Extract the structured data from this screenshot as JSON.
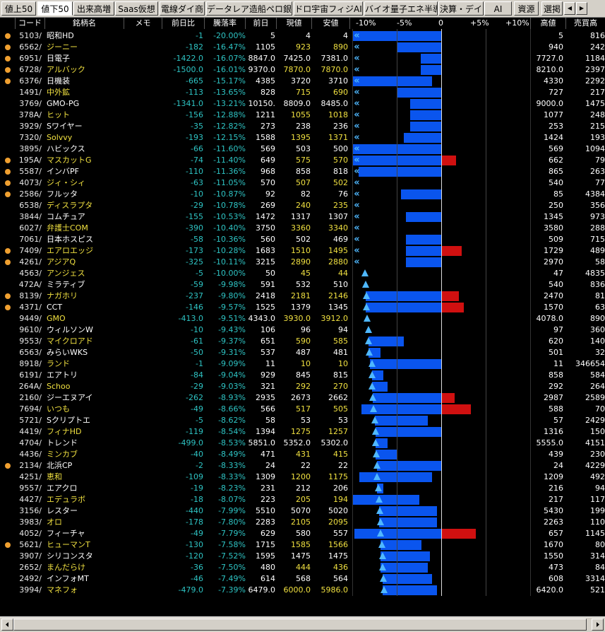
{
  "tabs": [
    {
      "label": "値上50",
      "active": false
    },
    {
      "label": "値下50",
      "active": true
    },
    {
      "label": "出来高増",
      "active": false
    },
    {
      "label": "Saas仮想",
      "active": false
    },
    {
      "label": "電線ダイ商",
      "active": false
    },
    {
      "label": "データレア造船ペロ銀行",
      "active": false
    },
    {
      "label": "ドロ宇宙フィジAI",
      "active": false
    },
    {
      "label": "バイオ量子エネ半導",
      "active": false
    },
    {
      "label": "決算・デイ",
      "active": false
    },
    {
      "label": "AI",
      "active": false
    },
    {
      "label": "資源",
      "active": false
    },
    {
      "label": "選掲",
      "active": false
    }
  ],
  "columns": {
    "code": "コード",
    "name": "銘柄名",
    "memo": "メモ",
    "chg": "前日比",
    "rate": "騰落率",
    "prev": "前日",
    "cur": "現値",
    "low": "安値",
    "hi": "高値",
    "vol": "売買高",
    "scale": [
      "-10%",
      "-5%",
      "0",
      "+5%",
      "+10%"
    ]
  },
  "colors": {
    "name_yellow": "#f0e040",
    "name_white": "#ffffff",
    "down": "#2ec4c4",
    "bar": "#0a55ee",
    "bar_red": "#d01010",
    "marker": "#4fb8ff",
    "dot": "#f0a030"
  },
  "rows": [
    {
      "code": "5103/",
      "name": "昭和HD",
      "nc": "w",
      "dot": true,
      "chg": "-1",
      "rate": "-20.00%",
      "prev": "5",
      "cur": "4",
      "low": "4",
      "hi": "5",
      "vol": "816",
      "bl": -1.0,
      "br": 0.0,
      "mk": "arrow",
      "mp": -0.95,
      "rc": 0,
      "rr": 0
    },
    {
      "code": "6562/",
      "name": "ジーニー",
      "nc": "y",
      "dot": true,
      "chg": "-182",
      "rate": "-16.47%",
      "prev": "1105",
      "cur": "923",
      "low": "890",
      "hi": "940",
      "vol": "242",
      "bl": -0.5,
      "br": 0.0,
      "mk": "arrow",
      "mp": -0.95,
      "rc": 0,
      "rr": 0
    },
    {
      "code": "6951/",
      "name": "日電子",
      "nc": "w",
      "dot": true,
      "chg": "-1422.0",
      "rate": "-16.07%",
      "prev": "8847.0",
      "cur": "7425.0",
      "low": "7381.0",
      "hi": "7727.0",
      "vol": "1184",
      "bl": -0.23,
      "br": 0.0,
      "mk": "arrow",
      "mp": -0.95,
      "rc": 0,
      "rr": 0
    },
    {
      "code": "6728/",
      "name": "アルバック",
      "nc": "y",
      "dot": true,
      "chg": "-1500.0",
      "rate": "-16.01%",
      "prev": "9370.0",
      "cur": "7870.0",
      "low": "7870.0",
      "hi": "8210.0",
      "vol": "2397",
      "bl": -0.23,
      "br": 0.0,
      "mk": "arrow",
      "mp": -0.95,
      "rc": 0,
      "rr": 0
    },
    {
      "code": "6376/",
      "name": "日機装",
      "nc": "w",
      "dot": true,
      "chg": "-665",
      "rate": "-15.17%",
      "prev": "4385",
      "cur": "3720",
      "low": "3710",
      "hi": "4330",
      "vol": "2292",
      "bl": -1.0,
      "br": -0.1,
      "mk": "arrow",
      "mp": -0.95,
      "rc": 0,
      "rr": 0
    },
    {
      "code": "1491/",
      "name": "中外鉱",
      "nc": "y",
      "dot": false,
      "chg": "-113",
      "rate": "-13.65%",
      "prev": "828",
      "cur": "715",
      "low": "690",
      "hi": "727",
      "vol": "217",
      "bl": -0.5,
      "br": 0.0,
      "mk": "arrow",
      "mp": -0.95,
      "rc": 0,
      "rr": 0
    },
    {
      "code": "3769/",
      "name": "GMO-PG",
      "nc": "w",
      "dot": false,
      "chg": "-1341.0",
      "rate": "-13.21%",
      "prev": "10150.",
      "cur": "8809.0",
      "low": "8485.0",
      "hi": "9000.0",
      "vol": "1475",
      "bl": -0.35,
      "br": 0.0,
      "mk": "arrow",
      "mp": -0.95,
      "rc": 0,
      "rr": 0
    },
    {
      "code": "378A/",
      "name": "ヒット",
      "nc": "y",
      "dot": false,
      "chg": "-156",
      "rate": "-12.88%",
      "prev": "1211",
      "cur": "1055",
      "low": "1018",
      "hi": "1077",
      "vol": "248",
      "bl": -0.35,
      "br": 0.0,
      "mk": "arrow",
      "mp": -0.95,
      "rc": 0,
      "rr": 0
    },
    {
      "code": "3929/",
      "name": "Sワイヤー",
      "nc": "w",
      "dot": false,
      "chg": "-35",
      "rate": "-12.82%",
      "prev": "273",
      "cur": "238",
      "low": "236",
      "hi": "253",
      "vol": "215",
      "bl": -0.35,
      "br": 0.0,
      "mk": "arrow",
      "mp": -0.95,
      "rc": 0,
      "rr": 0
    },
    {
      "code": "7320/",
      "name": "Solvvy",
      "nc": "y",
      "dot": false,
      "chg": "-193",
      "rate": "-12.15%",
      "prev": "1588",
      "cur": "1395",
      "low": "1371",
      "hi": "1424",
      "vol": "193",
      "bl": -0.42,
      "br": 0.0,
      "mk": "arrow",
      "mp": -0.95,
      "rc": 0,
      "rr": 0
    },
    {
      "code": "3895/",
      "name": "ハビックス",
      "nc": "w",
      "dot": false,
      "chg": "-66",
      "rate": "-11.60%",
      "prev": "569",
      "cur": "503",
      "low": "500",
      "hi": "569",
      "vol": "1094",
      "bl": -1.0,
      "br": 0.0,
      "mk": "arrow",
      "mp": -0.95,
      "rc": 0,
      "rr": 0
    },
    {
      "code": "195A/",
      "name": "マスカットG",
      "nc": "y",
      "dot": true,
      "chg": "-74",
      "rate": "-11.40%",
      "prev": "649",
      "cur": "575",
      "low": "570",
      "hi": "662",
      "vol": "79",
      "bl": -1.0,
      "br": 0.0,
      "mk": "arrow",
      "mp": -0.95,
      "rc": 0.0,
      "rr": 0.17
    },
    {
      "code": "5587/",
      "name": "インバPF",
      "nc": "w",
      "dot": true,
      "chg": "-110",
      "rate": "-11.36%",
      "prev": "968",
      "cur": "858",
      "low": "818",
      "hi": "865",
      "vol": "263",
      "bl": -0.93,
      "br": 0.0,
      "mk": "arrow",
      "mp": -0.95,
      "rc": 0,
      "rr": 0
    },
    {
      "code": "4073/",
      "name": "ジィ・シィ",
      "nc": "y",
      "dot": true,
      "chg": "-63",
      "rate": "-11.05%",
      "prev": "570",
      "cur": "507",
      "low": "502",
      "hi": "540",
      "vol": "77",
      "bl": -0.45,
      "br": -0.45,
      "mk": "arrow",
      "mp": -0.95,
      "rc": 0,
      "rr": 0
    },
    {
      "code": "2586/",
      "name": "フルッタ",
      "nc": "w",
      "dot": true,
      "chg": "-10",
      "rate": "-10.87%",
      "prev": "92",
      "cur": "82",
      "low": "76",
      "hi": "85",
      "vol": "4384",
      "bl": -0.45,
      "br": 0.0,
      "mk": "arrow",
      "mp": -0.95,
      "rc": 0,
      "rr": 0
    },
    {
      "code": "6538/",
      "name": "ディスラプタ",
      "nc": "y",
      "dot": false,
      "chg": "-29",
      "rate": "-10.78%",
      "prev": "269",
      "cur": "240",
      "low": "235",
      "hi": "250",
      "vol": "356",
      "bl": -0.45,
      "br": -0.45,
      "mk": "arrow",
      "mp": -0.95,
      "rc": 0,
      "rr": 0
    },
    {
      "code": "3844/",
      "name": "コムチュア",
      "nc": "w",
      "dot": false,
      "chg": "-155",
      "rate": "-10.53%",
      "prev": "1472",
      "cur": "1317",
      "low": "1307",
      "hi": "1345",
      "vol": "973",
      "bl": -0.4,
      "br": 0.0,
      "mk": "arrow",
      "mp": -0.95,
      "rc": 0,
      "rr": 0
    },
    {
      "code": "6027/",
      "name": "弁護士COM",
      "nc": "y",
      "dot": false,
      "chg": "-390",
      "rate": "-10.40%",
      "prev": "3750",
      "cur": "3360",
      "low": "3340",
      "hi": "3580",
      "vol": "288",
      "bl": -0.4,
      "br": -0.4,
      "mk": "arrow",
      "mp": -0.95,
      "rc": 0,
      "rr": 0
    },
    {
      "code": "7061/",
      "name": "日本ホスピス",
      "nc": "w",
      "dot": false,
      "chg": "-58",
      "rate": "-10.36%",
      "prev": "560",
      "cur": "502",
      "low": "469",
      "hi": "509",
      "vol": "715",
      "bl": -0.4,
      "br": 0.0,
      "mk": "arrow",
      "mp": -0.95,
      "rc": 0,
      "rr": 0
    },
    {
      "code": "7409/",
      "name": "エアロエッジ",
      "nc": "y",
      "dot": true,
      "chg": "-173",
      "rate": "-10.28%",
      "prev": "1683",
      "cur": "1510",
      "low": "1495",
      "hi": "1729",
      "vol": "489",
      "bl": -0.4,
      "br": 0.0,
      "mk": "arrow",
      "mp": -0.95,
      "rc": 0.0,
      "rr": 0.23
    },
    {
      "code": "4261/",
      "name": "アジアQ",
      "nc": "y",
      "dot": true,
      "chg": "-325",
      "rate": "-10.11%",
      "prev": "3215",
      "cur": "2890",
      "low": "2880",
      "hi": "2970",
      "vol": "58",
      "bl": -0.4,
      "br": 0.0,
      "mk": "arrow",
      "mp": -0.95,
      "rc": 0,
      "rr": 0
    },
    {
      "code": "4563/",
      "name": "アンジェス",
      "nc": "y",
      "dot": false,
      "chg": "-5",
      "rate": "-10.00%",
      "prev": "50",
      "cur": "45",
      "low": "44",
      "hi": "47",
      "vol": "4835",
      "bl": -0.4,
      "br": -0.4,
      "mk": "tri",
      "mp": -0.86,
      "rc": 0,
      "rr": 0
    },
    {
      "code": "472A/",
      "name": "ミラティブ",
      "nc": "w",
      "dot": false,
      "chg": "-59",
      "rate": "-9.98%",
      "prev": "591",
      "cur": "532",
      "low": "510",
      "hi": "540",
      "vol": "836",
      "bl": -0.18,
      "br": -0.18,
      "mk": "tri",
      "mp": -0.85,
      "rc": 0,
      "rr": 0
    },
    {
      "code": "8139/",
      "name": "ナガホリ",
      "nc": "y",
      "dot": true,
      "chg": "-237",
      "rate": "-9.80%",
      "prev": "2418",
      "cur": "2181",
      "low": "2146",
      "hi": "2470",
      "vol": "81",
      "bl": -0.85,
      "br": 0.0,
      "mk": "tri",
      "mp": -0.84,
      "rc": 0.0,
      "rr": 0.2
    },
    {
      "code": "4371/",
      "name": "CCT",
      "nc": "w",
      "dot": true,
      "chg": "-146",
      "rate": "-9.57%",
      "prev": "1525",
      "cur": "1379",
      "low": "1345",
      "hi": "1570",
      "vol": "63",
      "bl": -0.85,
      "br": 0.0,
      "mk": "tri",
      "mp": -0.84,
      "rc": 0.0,
      "rr": 0.25
    },
    {
      "code": "9449/",
      "name": "GMO",
      "nc": "y",
      "dot": false,
      "chg": "-413.0",
      "rate": "-9.51%",
      "prev": "4343.0",
      "cur": "3930.0",
      "low": "3912.0",
      "hi": "4078.0",
      "vol": "890",
      "bl": -0.25,
      "br": -0.25,
      "mk": "tri",
      "mp": -0.83,
      "rc": 0,
      "rr": 0
    },
    {
      "code": "9610/",
      "name": "ウィルソンW",
      "nc": "w",
      "dot": false,
      "chg": "-10",
      "rate": "-9.43%",
      "prev": "106",
      "cur": "96",
      "low": "94",
      "hi": "97",
      "vol": "360",
      "bl": -0.23,
      "br": -0.23,
      "mk": "tri",
      "mp": -0.82,
      "rc": 0,
      "rr": 0
    },
    {
      "code": "9553/",
      "name": "マイクロアド",
      "nc": "y",
      "dot": false,
      "chg": "-61",
      "rate": "-9.37%",
      "prev": "651",
      "cur": "590",
      "low": "585",
      "hi": "620",
      "vol": "140",
      "bl": -0.82,
      "br": -0.42,
      "mk": "tri",
      "mp": -0.82,
      "rc": 0,
      "rr": 0
    },
    {
      "code": "6563/",
      "name": "みらいWKS",
      "nc": "w",
      "dot": false,
      "chg": "-50",
      "rate": "-9.31%",
      "prev": "537",
      "cur": "487",
      "low": "481",
      "hi": "501",
      "vol": "32",
      "bl": -0.82,
      "br": -0.68,
      "mk": "tri",
      "mp": -0.81,
      "rc": 0,
      "rr": 0
    },
    {
      "code": "8918/",
      "name": "ランド",
      "nc": "y",
      "dot": false,
      "chg": "-1",
      "rate": "-9.09%",
      "prev": "11",
      "cur": "10",
      "low": "10",
      "hi": "11",
      "vol": "346654",
      "bl": -0.8,
      "br": 0.0,
      "mk": "tri",
      "mp": -0.78,
      "rc": 0,
      "rr": 0
    },
    {
      "code": "6191/",
      "name": "エアトリ",
      "nc": "w",
      "dot": false,
      "chg": "-84",
      "rate": "-9.04%",
      "prev": "929",
      "cur": "845",
      "low": "815",
      "hi": "858",
      "vol": "584",
      "bl": -0.78,
      "br": -0.65,
      "mk": "tri",
      "mp": -0.78,
      "rc": 0,
      "rr": 0
    },
    {
      "code": "264A/",
      "name": "Schoo",
      "nc": "y",
      "dot": false,
      "chg": "-29",
      "rate": "-9.03%",
      "prev": "321",
      "cur": "292",
      "low": "270",
      "hi": "292",
      "vol": "264",
      "bl": -0.78,
      "br": -0.6,
      "mk": "tri",
      "mp": -0.78,
      "rc": 0,
      "rr": 0
    },
    {
      "code": "2160/",
      "name": "ジーエヌアイ",
      "nc": "w",
      "dot": false,
      "chg": "-262",
      "rate": "-8.93%",
      "prev": "2935",
      "cur": "2673",
      "low": "2662",
      "hi": "2987",
      "vol": "2589",
      "bl": -0.77,
      "br": 0.0,
      "mk": "tri",
      "mp": -0.77,
      "rc": 0.0,
      "rr": 0.15
    },
    {
      "code": "7694/",
      "name": "いつも",
      "nc": "y",
      "dot": false,
      "chg": "-49",
      "rate": "-8.66%",
      "prev": "566",
      "cur": "517",
      "low": "505",
      "hi": "588",
      "vol": "70",
      "bl": -0.9,
      "br": 0.0,
      "mk": "tri",
      "mp": -0.76,
      "rc": 0.0,
      "rr": 0.33
    },
    {
      "code": "5721/",
      "name": "Sクリプトエ",
      "nc": "w",
      "dot": false,
      "chg": "-5",
      "rate": "-8.62%",
      "prev": "58",
      "cur": "53",
      "low": "53",
      "hi": "57",
      "vol": "2429",
      "bl": -0.75,
      "br": -0.15,
      "mk": "tri",
      "mp": -0.75,
      "rc": 0,
      "rr": 0
    },
    {
      "code": "4419/",
      "name": "フィナHD",
      "nc": "y",
      "dot": false,
      "chg": "-119",
      "rate": "-8.54%",
      "prev": "1394",
      "cur": "1275",
      "low": "1257",
      "hi": "1316",
      "vol": "150",
      "bl": -0.74,
      "br": 0.0,
      "mk": "tri",
      "mp": -0.74,
      "rc": 0,
      "rr": 0
    },
    {
      "code": "4704/",
      "name": "トレンド",
      "nc": "w",
      "dot": false,
      "chg": "-499.0",
      "rate": "-8.53%",
      "prev": "5851.0",
      "cur": "5352.0",
      "low": "5302.0",
      "hi": "5555.0",
      "vol": "4151",
      "bl": -0.74,
      "br": -0.6,
      "mk": "tri",
      "mp": -0.74,
      "rc": 0,
      "rr": 0
    },
    {
      "code": "4436/",
      "name": "ミンカブ",
      "nc": "y",
      "dot": false,
      "chg": "-40",
      "rate": "-8.49%",
      "prev": "471",
      "cur": "431",
      "low": "415",
      "hi": "439",
      "vol": "230",
      "bl": -0.74,
      "br": -0.5,
      "mk": "tri",
      "mp": -0.73,
      "rc": 0,
      "rr": 0
    },
    {
      "code": "2134/",
      "name": "北浜CP",
      "nc": "w",
      "dot": true,
      "chg": "-2",
      "rate": "-8.33%",
      "prev": "24",
      "cur": "22",
      "low": "22",
      "hi": "24",
      "vol": "4229",
      "bl": -0.72,
      "br": 0.0,
      "mk": "tri",
      "mp": -0.72,
      "rc": 0,
      "rr": 0
    },
    {
      "code": "4251/",
      "name": "恵和",
      "nc": "y",
      "dot": false,
      "chg": "-109",
      "rate": "-8.33%",
      "prev": "1309",
      "cur": "1200",
      "low": "1175",
      "hi": "1209",
      "vol": "492",
      "bl": -0.92,
      "br": -0.1,
      "mk": "tri",
      "mp": -0.72,
      "rc": 0,
      "rr": 0
    },
    {
      "code": "9557/",
      "name": "エアクロ",
      "nc": "w",
      "dot": false,
      "chg": "-19",
      "rate": "-8.23%",
      "prev": "231",
      "cur": "212",
      "low": "206",
      "hi": "216",
      "vol": "94",
      "bl": -0.72,
      "br": -0.65,
      "mk": "tri",
      "mp": -0.71,
      "rc": 0,
      "rr": 0
    },
    {
      "code": "4427/",
      "name": "エデュラボ",
      "nc": "y",
      "dot": false,
      "chg": "-18",
      "rate": "-8.07%",
      "prev": "223",
      "cur": "205",
      "low": "194",
      "hi": "217",
      "vol": "117",
      "bl": -1.0,
      "br": -0.25,
      "mk": "tri",
      "mp": -0.7,
      "rc": 0,
      "rr": 0
    },
    {
      "code": "3156/",
      "name": "レスター",
      "nc": "w",
      "dot": false,
      "chg": "-440",
      "rate": "-7.99%",
      "prev": "5510",
      "cur": "5070",
      "low": "5020",
      "hi": "5430",
      "vol": "199",
      "bl": -0.7,
      "br": -0.05,
      "mk": "tri",
      "mp": -0.69,
      "rc": 0,
      "rr": 0
    },
    {
      "code": "3983/",
      "name": "オロ",
      "nc": "y",
      "dot": false,
      "chg": "-178",
      "rate": "-7.80%",
      "prev": "2283",
      "cur": "2105",
      "low": "2095",
      "hi": "2263",
      "vol": "110",
      "bl": -0.7,
      "br": -0.05,
      "mk": "tri",
      "mp": -0.68,
      "rc": 0,
      "rr": 0
    },
    {
      "code": "4052/",
      "name": "フィーチャ",
      "nc": "w",
      "dot": false,
      "chg": "-49",
      "rate": "-7.79%",
      "prev": "629",
      "cur": "580",
      "low": "557",
      "hi": "657",
      "vol": "1145",
      "bl": -0.98,
      "br": 0.0,
      "mk": "tri",
      "mp": -0.68,
      "rc": 0.0,
      "rr": 0.39
    },
    {
      "code": "5621/",
      "name": "ヒューマンT",
      "nc": "y",
      "dot": true,
      "chg": "-130",
      "rate": "-7.58%",
      "prev": "1715",
      "cur": "1585",
      "low": "1566",
      "hi": "1670",
      "vol": "80",
      "bl": -0.68,
      "br": -0.22,
      "mk": "tri",
      "mp": -0.67,
      "rc": 0,
      "rr": 0
    },
    {
      "code": "3907/",
      "name": "シリコンスタ",
      "nc": "w",
      "dot": false,
      "chg": "-120",
      "rate": "-7.52%",
      "prev": "1595",
      "cur": "1475",
      "low": "1475",
      "hi": "1550",
      "vol": "314",
      "bl": -0.68,
      "br": -0.13,
      "mk": "tri",
      "mp": -0.66,
      "rc": 0,
      "rr": 0
    },
    {
      "code": "2652/",
      "name": "まんだらけ",
      "nc": "y",
      "dot": false,
      "chg": "-36",
      "rate": "-7.50%",
      "prev": "480",
      "cur": "444",
      "low": "436",
      "hi": "473",
      "vol": "84",
      "bl": -0.68,
      "br": -0.15,
      "mk": "tri",
      "mp": -0.66,
      "rc": 0,
      "rr": 0
    },
    {
      "code": "2492/",
      "name": "インフォMT",
      "nc": "w",
      "dot": false,
      "chg": "-46",
      "rate": "-7.49%",
      "prev": "614",
      "cur": "568",
      "low": "564",
      "hi": "608",
      "vol": "3314",
      "bl": -0.66,
      "br": -0.1,
      "mk": "tri",
      "mp": -0.65,
      "rc": 0,
      "rr": 0
    },
    {
      "code": "3994/",
      "name": "マネフォ",
      "nc": "y",
      "dot": false,
      "chg": "-479.0",
      "rate": "-7.39%",
      "prev": "6479.0",
      "cur": "6000.0",
      "low": "5986.0",
      "hi": "6420.0",
      "vol": "521",
      "bl": -0.66,
      "br": -0.05,
      "mk": "tri",
      "mp": -0.64,
      "rc": 0,
      "rr": 0
    }
  ]
}
